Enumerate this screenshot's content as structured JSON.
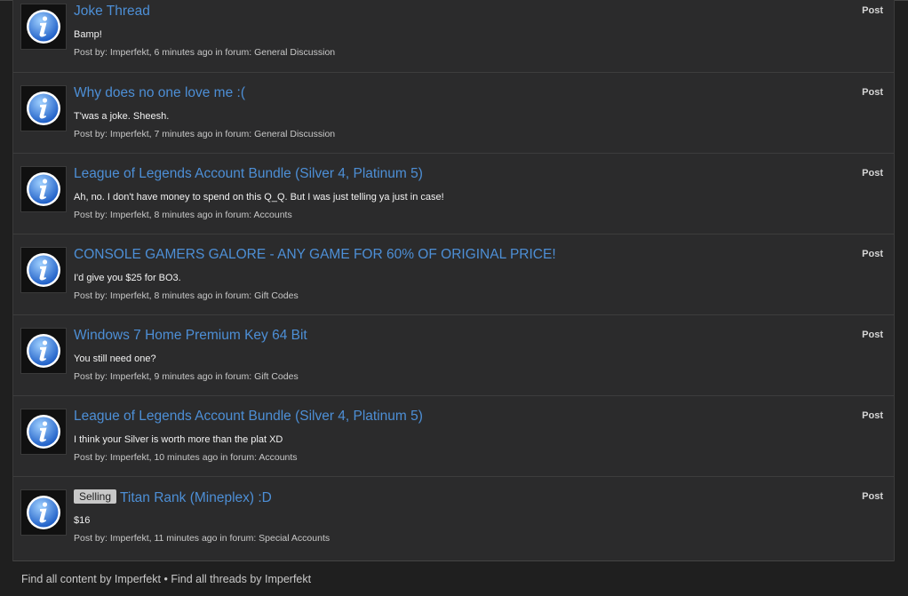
{
  "posts": [
    {
      "title": "Joke Thread",
      "badge": "",
      "snippet": "Bamp!",
      "meta": "Post by: Imperfekt, 6 minutes ago in forum: General Discussion",
      "type": "Post"
    },
    {
      "title": "Why does no one love me :(",
      "badge": "",
      "snippet": "T'was a joke. Sheesh.",
      "meta": "Post by: Imperfekt, 7 minutes ago in forum: General Discussion",
      "type": "Post"
    },
    {
      "title": "League of Legends Account Bundle (Silver 4, Platinum 5)",
      "badge": "",
      "snippet": "Ah, no. I don't have money to spend on this Q_Q. But I was just telling ya just in case!",
      "meta": "Post by: Imperfekt, 8 minutes ago in forum: Accounts",
      "type": "Post"
    },
    {
      "title": "CONSOLE GAMERS GALORE - ANY GAME FOR 60% OF ORIGINAL PRICE!",
      "badge": "",
      "snippet": "I'd give you $25 for BO3.",
      "meta": "Post by: Imperfekt, 8 minutes ago in forum: Gift Codes",
      "type": "Post"
    },
    {
      "title": "Windows 7 Home Premium Key 64 Bit",
      "badge": "",
      "snippet": "You still need one?",
      "meta": "Post by: Imperfekt, 9 minutes ago in forum: Gift Codes",
      "type": "Post"
    },
    {
      "title": "League of Legends Account Bundle (Silver 4, Platinum 5)",
      "badge": "",
      "snippet": "I think your Silver is worth more than the plat XD",
      "meta": "Post by: Imperfekt, 10 minutes ago in forum: Accounts",
      "type": "Post"
    },
    {
      "title": "Titan Rank (Mineplex) :D",
      "badge": "Selling",
      "snippet": "$16",
      "meta": "Post by: Imperfekt, 11 minutes ago in forum: Special Accounts",
      "type": "Post"
    }
  ],
  "footer": {
    "find_content": "Find all content by Imperfekt",
    "separator": "•",
    "find_threads": "Find all threads by Imperfekt"
  },
  "icon": "info-icon"
}
